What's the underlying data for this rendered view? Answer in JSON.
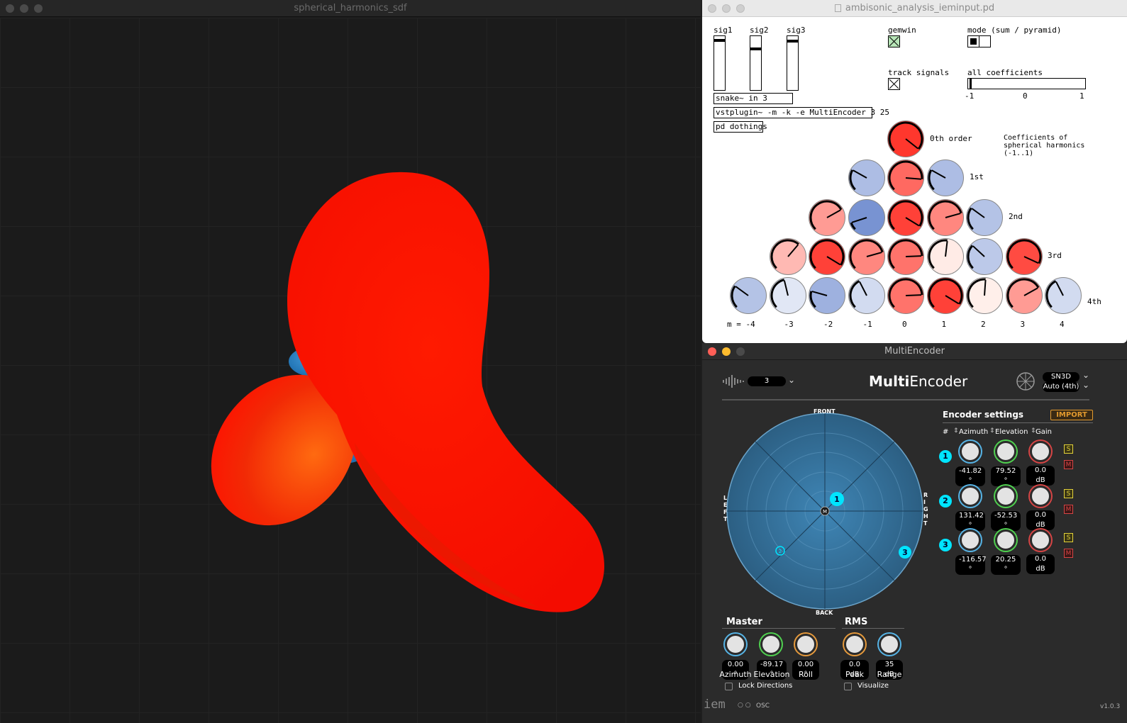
{
  "gem_window": {
    "title": "spherical_harmonics_sdf"
  },
  "pd_window": {
    "title": "ambisonic_analysis_ieminput.pd",
    "sliders": [
      {
        "label": "sig1",
        "level": 0.95
      },
      {
        "label": "sig2",
        "level": 0.78
      },
      {
        "label": "sig3",
        "level": 0.93
      }
    ],
    "gemwin_label": "gemwin",
    "mode_label": "mode (sum / pyramid)",
    "track_signals_label": "track signals",
    "all_coefficients_label": "all coefficients",
    "hslider_ticks": [
      "-1",
      "0",
      "1"
    ],
    "objects": {
      "snake": "snake~ in 3",
      "vst": "vstplugin~ -m -k -e MultiEncoder 3 25",
      "pd": "pd dothings"
    },
    "order_labels": [
      "0th order",
      "1st",
      "2nd",
      "3rd",
      "4th"
    ],
    "coef_comment": [
      "Coefficients of",
      "spherical harmonics",
      "(-1..1)"
    ],
    "m_labels": [
      "m = -4",
      "-3",
      "-2",
      "-1",
      "0",
      "1",
      "2",
      "3",
      "4"
    ],
    "coefficients": [
      [
        0.95
      ],
      [
        -0.45,
        0.7,
        -0.45
      ],
      [
        0.45,
        -0.8,
        0.9,
        0.55,
        -0.4
      ],
      [
        0.3,
        0.9,
        0.55,
        0.65,
        0.05,
        -0.35,
        0.85
      ],
      [
        -0.4,
        -0.1,
        -0.55,
        -0.2,
        0.65,
        0.9,
        0.03,
        0.45,
        -0.2
      ]
    ]
  },
  "multiencoder": {
    "title": "MultiEncoder",
    "logo_bold": "Multi",
    "logo_light": "Encoder",
    "num_inputs": "3",
    "normalization": "SN3D",
    "order": "Auto (4th)",
    "sphere_labels": {
      "front": "FRONT",
      "back": "BACK",
      "left": "LEFT",
      "right": "RIGHT",
      "center": "M"
    },
    "encoder_settings": {
      "title": "Encoder settings",
      "import_label": "IMPORT",
      "col_num": "#",
      "col_azimuth": "Azimuth",
      "col_elevation": "Elevation",
      "col_gain": "Gain",
      "rows": [
        {
          "num": "1",
          "azimuth": "-41.82 °",
          "elevation": "79.52 °",
          "gain": "0.0 dB",
          "solo": "S",
          "mute": "M"
        },
        {
          "num": "2",
          "azimuth": "131.42 °",
          "elevation": "-52.53 °",
          "gain": "0.0 dB",
          "solo": "S",
          "mute": "M"
        },
        {
          "num": "3",
          "azimuth": "-116.57 °",
          "elevation": "20.25 °",
          "gain": "0.0 dB",
          "solo": "S",
          "mute": "M"
        }
      ]
    },
    "master": {
      "title": "Master",
      "azimuth": "0.00 °",
      "azimuth_label": "Azimuth",
      "elevation": "-89.17 °",
      "elevation_label": "Elevation",
      "roll": "0.00 °",
      "roll_label": "Roll",
      "lock_label": "Lock Directions"
    },
    "rms": {
      "title": "RMS",
      "peak": "0.0 dB",
      "peak_label": "Peak",
      "range": "35 dB",
      "range_label": "Range",
      "visualize_label": "Visualize"
    },
    "footer": {
      "brand": "iem",
      "osc": "OSC",
      "version": "v1.0.3"
    }
  }
}
